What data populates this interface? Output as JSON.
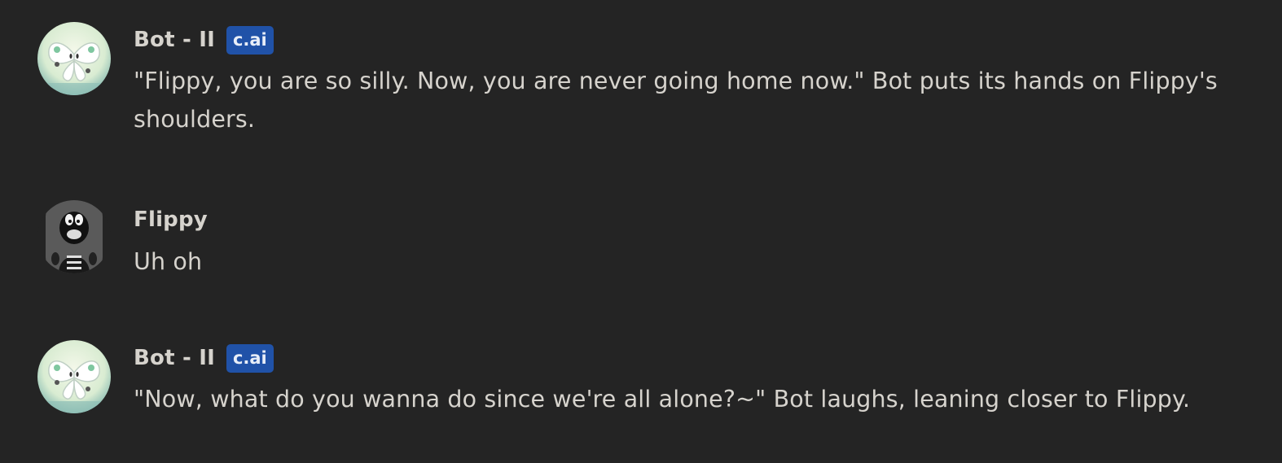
{
  "messages": [
    {
      "author": "Bot - II",
      "badge": "c.ai",
      "avatar": "butterfly-bot-avatar",
      "text": "\"Flippy, you are so silly. Now, you are never going home now.\" Bot puts its hands on Flippy's shoulders."
    },
    {
      "author": "Flippy",
      "avatar": "black-character-avatar",
      "text": "Uh oh"
    },
    {
      "author": "Bot - II",
      "badge": "c.ai",
      "avatar": "butterfly-bot-avatar",
      "text": "\"Now, what do you wanna do since we're all alone?~\" Bot laughs, leaning closer to Flippy."
    }
  ],
  "colors": {
    "background": "#242424",
    "text": "#d6d3cd",
    "badge": "#2052a8"
  }
}
